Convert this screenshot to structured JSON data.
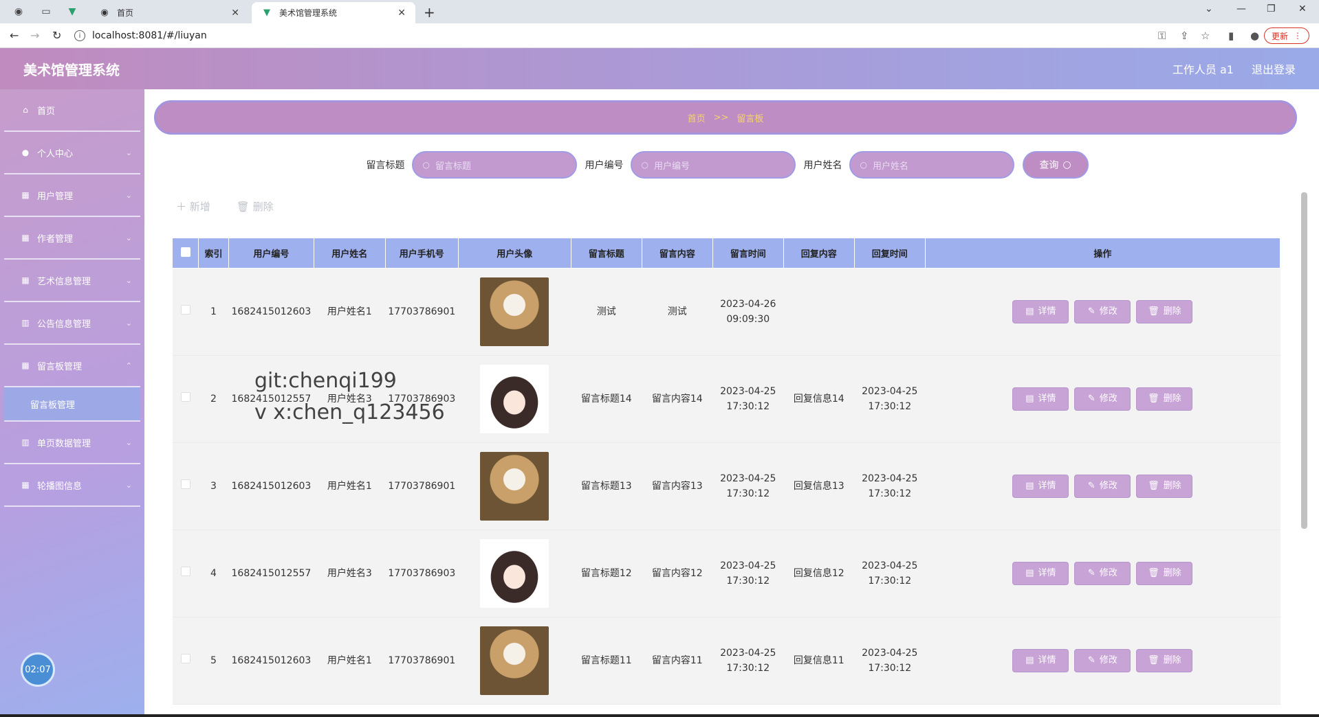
{
  "browser": {
    "tabs": [
      {
        "title": "首页",
        "active": false
      },
      {
        "title": "美术馆管理系统",
        "active": true
      }
    ],
    "url": "localhost:8081/#/liuyan",
    "update_label": "更新"
  },
  "header": {
    "title": "美术馆管理系统",
    "user": "工作人员 a1",
    "logout": "退出登录"
  },
  "sidebar": {
    "items": [
      {
        "label": "首页",
        "icon": "home-icon"
      },
      {
        "label": "个人中心",
        "icon": "user-icon"
      },
      {
        "label": "用户管理",
        "icon": "grid-icon"
      },
      {
        "label": "作者管理",
        "icon": "grid-icon"
      },
      {
        "label": "艺术信息管理",
        "icon": "grid-icon"
      },
      {
        "label": "公告信息管理",
        "icon": "chart-icon"
      },
      {
        "label": "留言板管理",
        "icon": "grid-icon"
      }
    ],
    "subitem": "留言板管理",
    "items_after": [
      {
        "label": "单页数据管理",
        "icon": "chart-icon"
      },
      {
        "label": "轮播图信息",
        "icon": "grid-icon"
      }
    ],
    "clock": "02:07"
  },
  "breadcrumb": {
    "home": "首页",
    "sep": ">>",
    "current": "留言板"
  },
  "search": {
    "fields": [
      {
        "label": "留言标题",
        "placeholder": "留言标题"
      },
      {
        "label": "用户编号",
        "placeholder": "用户编号"
      },
      {
        "label": "用户姓名",
        "placeholder": "用户姓名"
      }
    ],
    "query_label": "查询"
  },
  "actions": {
    "add": "新增",
    "delete": "删除"
  },
  "table": {
    "columns": [
      "索引",
      "用户编号",
      "用户姓名",
      "用户手机号",
      "用户头像",
      "留言标题",
      "留言内容",
      "留言时间",
      "回复内容",
      "回复时间",
      "操作"
    ],
    "rows": [
      {
        "index": "1",
        "user_no": "1682415012603",
        "name": "用户姓名1",
        "phone": "17703786901",
        "avatar": "cat",
        "title": "测试",
        "content": "测试",
        "time": "2023-04-26 09:09:30",
        "reply": "",
        "reply_time": ""
      },
      {
        "index": "2",
        "user_no": "1682415012557",
        "name": "用户姓名3",
        "phone": "17703786903",
        "avatar": "girl",
        "title": "留言标题14",
        "content": "留言内容14",
        "time": "2023-04-25 17:30:12",
        "reply": "回复信息14",
        "reply_time": "2023-04-25 17:30:12"
      },
      {
        "index": "3",
        "user_no": "1682415012603",
        "name": "用户姓名1",
        "phone": "17703786901",
        "avatar": "cat",
        "title": "留言标题13",
        "content": "留言内容13",
        "time": "2023-04-25 17:30:12",
        "reply": "回复信息13",
        "reply_time": "2023-04-25 17:30:12"
      },
      {
        "index": "4",
        "user_no": "1682415012557",
        "name": "用户姓名3",
        "phone": "17703786903",
        "avatar": "girl",
        "title": "留言标题12",
        "content": "留言内容12",
        "time": "2023-04-25 17:30:12",
        "reply": "回复信息12",
        "reply_time": "2023-04-25 17:30:12"
      },
      {
        "index": "5",
        "user_no": "1682415012603",
        "name": "用户姓名1",
        "phone": "17703786901",
        "avatar": "cat",
        "title": "留言标题11",
        "content": "留言内容11",
        "time": "2023-04-25 17:30:12",
        "reply": "回复信息11",
        "reply_time": "2023-04-25 17:30:12"
      }
    ],
    "op_labels": {
      "detail": "详情",
      "edit": "修改",
      "delete": "删除"
    }
  },
  "watermark": [
    "git:chenqi199",
    "v x:chen_q123456"
  ]
}
